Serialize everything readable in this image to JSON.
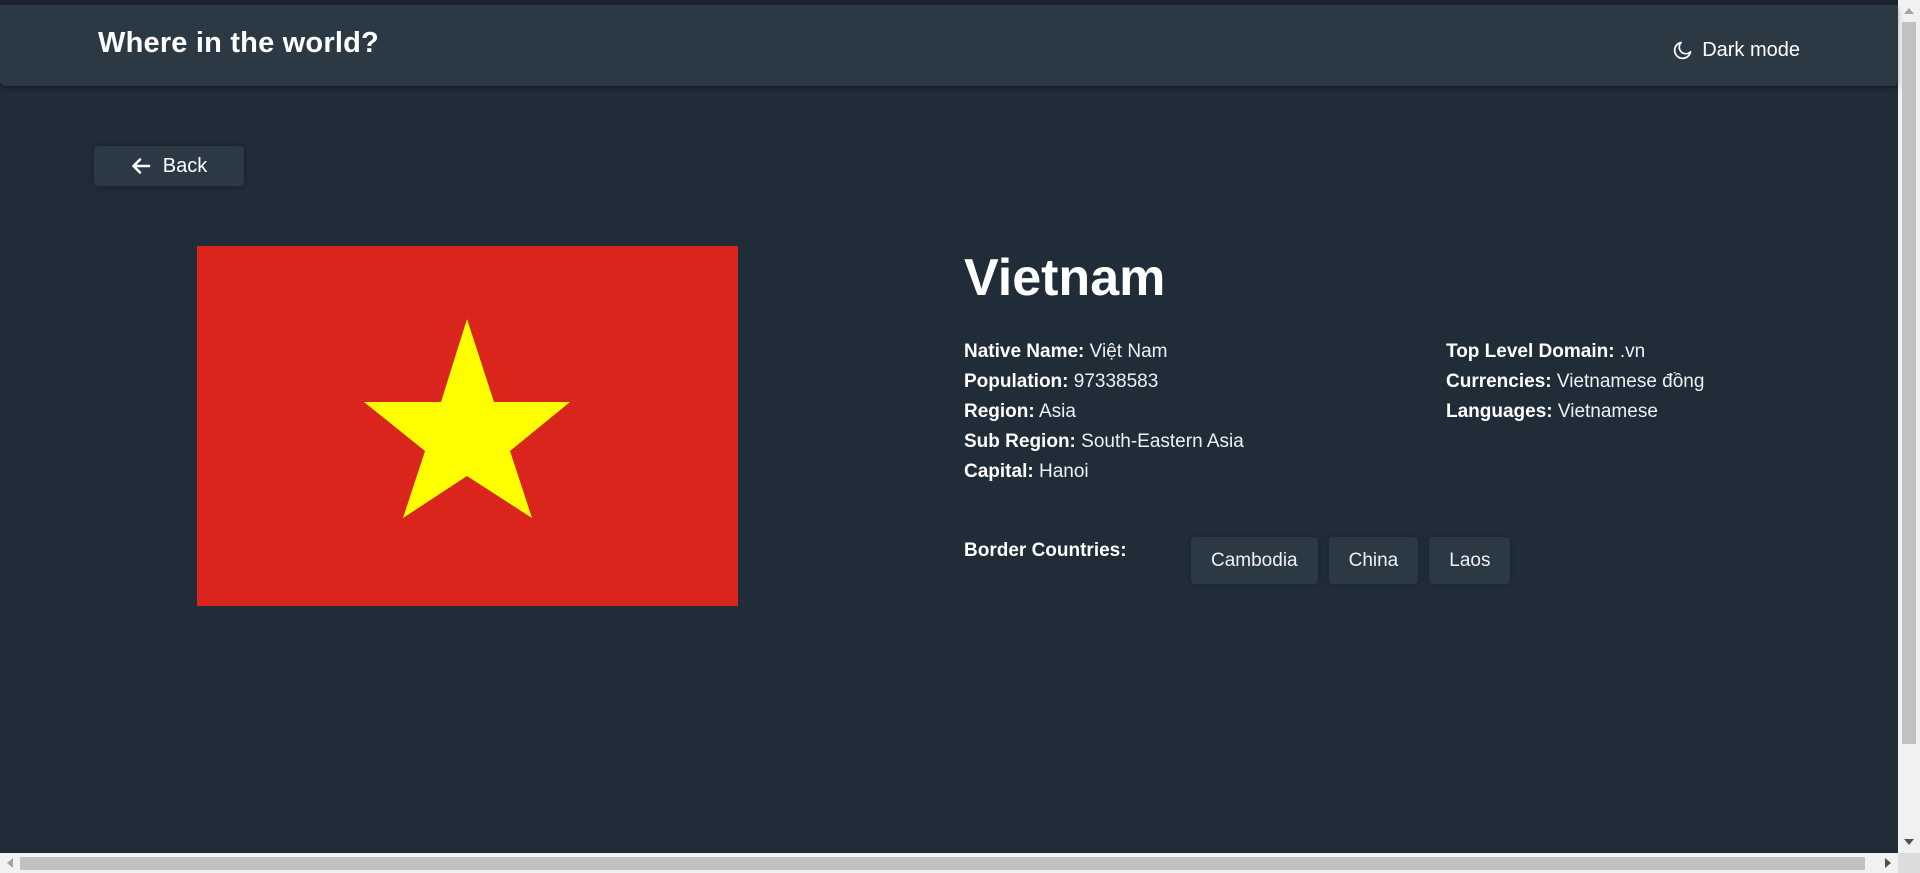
{
  "header": {
    "title": "Where in the world?",
    "mode_label": "Dark mode",
    "mode_icon": "moon-icon"
  },
  "nav": {
    "back_label": "Back",
    "back_icon": "arrow-left-icon"
  },
  "country": {
    "name": "Vietnam",
    "flag": {
      "background": "#da251d",
      "star": "#ffff00"
    },
    "details_left": [
      {
        "label": "Native Name:",
        "value": "Việt Nam"
      },
      {
        "label": "Population:",
        "value": "97338583"
      },
      {
        "label": "Region:",
        "value": "Asia"
      },
      {
        "label": "Sub Region:",
        "value": "South-Eastern Asia"
      },
      {
        "label": "Capital:",
        "value": "Hanoi"
      }
    ],
    "details_right": [
      {
        "label": "Top Level Domain:",
        "value": ".vn"
      },
      {
        "label": "Currencies:",
        "value": "Vietnamese đồng"
      },
      {
        "label": "Languages:",
        "value": "Vietnamese"
      }
    ],
    "border_label": "Border Countries:",
    "border_countries": [
      "Cambodia",
      "China",
      "Laos"
    ]
  },
  "colors": {
    "background": "#202c37",
    "element": "#2b3945",
    "text": "#ffffff"
  }
}
